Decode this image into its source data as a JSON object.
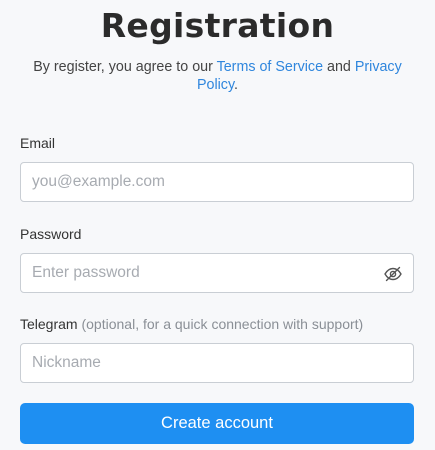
{
  "page": {
    "title": "Registration",
    "subtitle_prefix": "By register, you agree to our ",
    "terms_link": "Terms of Service",
    "subtitle_and": " and ",
    "privacy_link": "Privacy Policy",
    "subtitle_suffix": "."
  },
  "form": {
    "email": {
      "label": "Email",
      "value": "",
      "placeholder": "you@example.com"
    },
    "password": {
      "label": "Password",
      "value": "",
      "placeholder": "Enter password",
      "toggle_icon": "eye-slash-icon"
    },
    "telegram": {
      "label": "Telegram",
      "hint": "(optional, for a quick connection with support)",
      "value": "",
      "placeholder": "Nickname"
    },
    "submit_label": "Create account"
  },
  "colors": {
    "background": "#f7f8fa",
    "accent": "#1e8ff2",
    "link": "#2f86dd",
    "border": "#c9ced4"
  }
}
